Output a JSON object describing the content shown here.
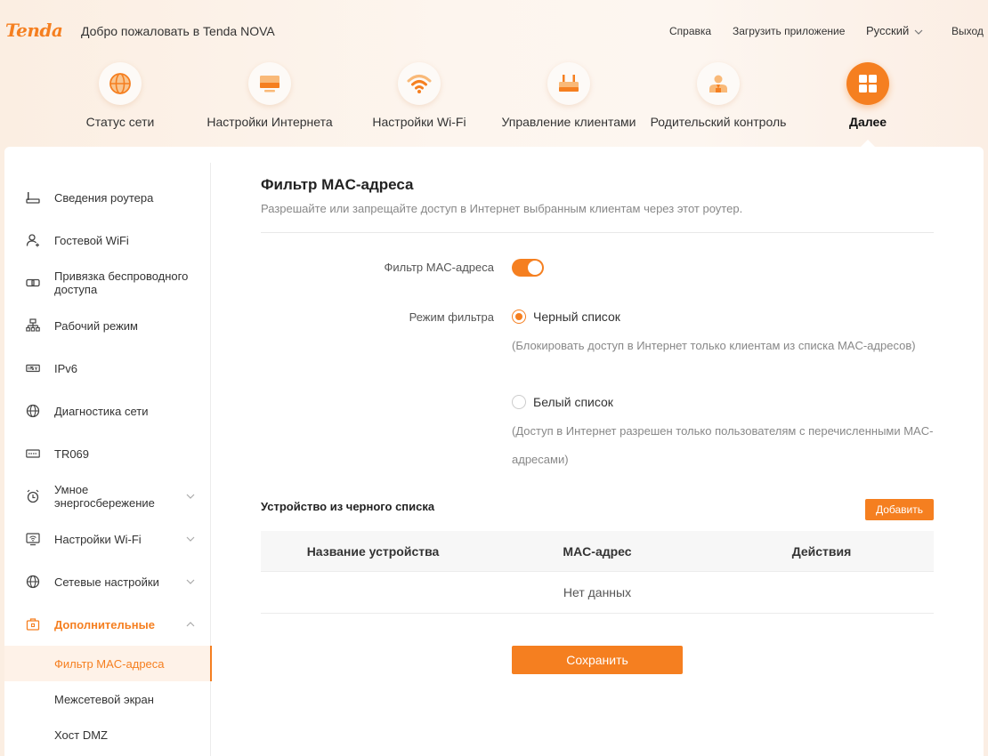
{
  "header": {
    "logo": "Tenda",
    "welcome": "Добро пожаловать в Tenda NOVA",
    "help": "Справка",
    "download_app": "Загрузить приложение",
    "language": "Русский",
    "exit": "Выход"
  },
  "nav": {
    "tabs": [
      {
        "label": "Статус сети",
        "icon": "globe-icon"
      },
      {
        "label": "Настройки Интернета",
        "icon": "monitor-icon"
      },
      {
        "label": "Настройки Wi-Fi",
        "icon": "wifi-icon"
      },
      {
        "label": "Управление клиентами",
        "icon": "router-icon"
      },
      {
        "label": "Родительский контроль",
        "icon": "person-icon"
      },
      {
        "label": "Далее",
        "icon": "grid-icon",
        "active": true
      }
    ]
  },
  "sidebar": {
    "items": [
      {
        "label": "Сведения роутера",
        "icon": "router-info-icon"
      },
      {
        "label": "Гостевой WiFi",
        "icon": "guest-icon"
      },
      {
        "label": "Привязка беспроводного доступа",
        "icon": "link-icon"
      },
      {
        "label": "Рабочий режим",
        "icon": "topology-icon"
      },
      {
        "label": "IPv6",
        "icon": "ipv6-icon"
      },
      {
        "label": "Диагностика сети",
        "icon": "globe-icon"
      },
      {
        "label": "TR069",
        "icon": "tr069-icon"
      },
      {
        "label": "Умное энергосбережение",
        "icon": "alarm-icon"
      },
      {
        "label": "Настройки Wi-Fi",
        "icon": "wifi-settings-icon"
      },
      {
        "label": "Сетевые настройки",
        "icon": "globe-icon"
      },
      {
        "label": "Дополнительные",
        "icon": "toolbox-icon"
      }
    ],
    "sub_items": [
      {
        "label": "Фильтр MAC-адреса",
        "active": true
      },
      {
        "label": "Межсетевой экран"
      },
      {
        "label": "Хост DMZ"
      }
    ]
  },
  "content": {
    "title": "Фильтр MAC-адреса",
    "description": "Разрешайте или запрещайте доступ в Интернет выбранным клиентам через этот роутер.",
    "mac_filter_label": "Фильтр MAC-адреса",
    "mac_filter_enabled": true,
    "filter_mode_label": "Режим фильтра",
    "blacklist_label": "Черный список",
    "blacklist_hint": "(Блокировать доступ в Интернет только клиентам из списка MAC-адресов)",
    "whitelist_label": "Белый список",
    "whitelist_hint": "(Доступ в Интернет разрешен только пользователям с перечисленными MAC-адресами)",
    "selected_mode": "blacklist",
    "device_section_title": "Устройство из черного списка",
    "add_button": "Добавить",
    "table": {
      "columns": [
        "Название устройства",
        "MAC-адрес",
        "Действия"
      ],
      "empty_text": "Нет данных"
    },
    "save_button": "Сохранить"
  },
  "colors": {
    "accent": "#f57f20",
    "active_bg": "#fef2e8"
  }
}
